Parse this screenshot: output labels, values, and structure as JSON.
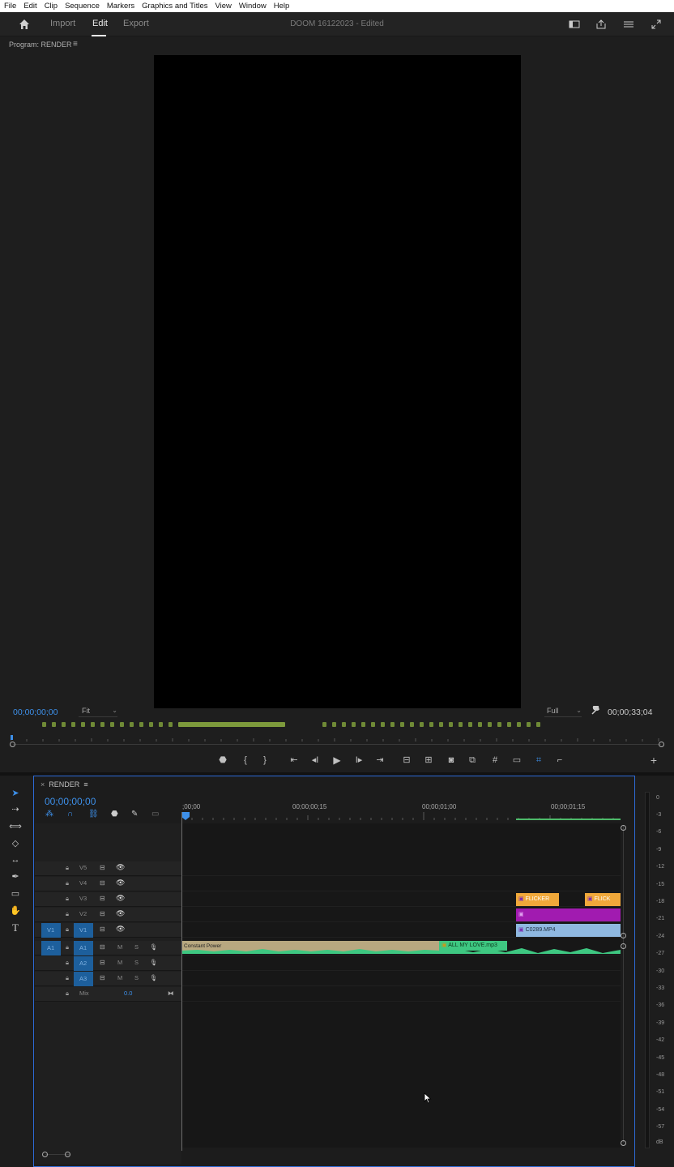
{
  "menu": [
    "File",
    "Edit",
    "Clip",
    "Sequence",
    "Markers",
    "Graphics and Titles",
    "View",
    "Window",
    "Help"
  ],
  "appbar": {
    "tabs": [
      "Import",
      "Edit",
      "Export"
    ],
    "active_tab": "Edit",
    "title": "DOOM 16122023 - Edited",
    "right_icons": [
      "workspace-icon",
      "share-icon",
      "menu-lines-icon",
      "fullscreen-icon"
    ]
  },
  "program": {
    "label": "Program: RENDER",
    "menu_glyph": "≡",
    "timecode_current": "00;00;00;00",
    "fit_label": "Fit",
    "quality_label": "Full",
    "timecode_duration": "00;00;33;04"
  },
  "timeline": {
    "tab_label": "RENDER",
    "timecode": "00;00;00;00",
    "ruler": [
      ";00;00",
      "00;00;00;15",
      "00;00;01;00",
      "00;00;01;15"
    ],
    "video_tracks": [
      {
        "name": "V5"
      },
      {
        "name": "V4"
      },
      {
        "name": "V3"
      },
      {
        "name": "V2"
      },
      {
        "name": "V1",
        "source": "V1"
      }
    ],
    "audio_tracks": [
      {
        "name": "A1",
        "source": "A1",
        "m": "M",
        "s": "S"
      },
      {
        "name": "A2",
        "m": "M",
        "s": "S"
      },
      {
        "name": "A3",
        "m": "M",
        "s": "S"
      }
    ],
    "mix": {
      "label": "Mix",
      "value": "0.0"
    },
    "clips": {
      "flicker1": "FLICKER",
      "flicker2": "FLICK",
      "purple": "",
      "c0289": "C0289.MP4",
      "transition": "Constant Power",
      "audio": "ALL MY LOVE.mp3"
    }
  },
  "meter_labels": [
    "0",
    "-3",
    "-6",
    "-9",
    "-12",
    "-15",
    "-18",
    "-21",
    "-24",
    "-27",
    "-30",
    "-33",
    "-36",
    "-39",
    "-42",
    "-45",
    "-48",
    "-51",
    "-54",
    "-57",
    "dB"
  ],
  "colors": {
    "accent": "#3d8fe8",
    "flicker": "#f0a83a",
    "purple": "#a11bb0",
    "mp4": "#8fb8e0",
    "audio": "#3ec781"
  }
}
